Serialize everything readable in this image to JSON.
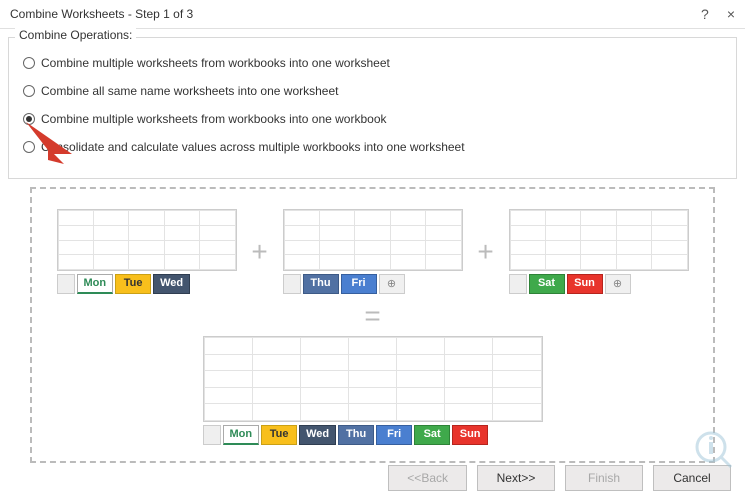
{
  "titlebar": {
    "title": "Combine Worksheets - Step 1 of 3",
    "help": "?",
    "close": "×"
  },
  "operations": {
    "legend": "Combine Operations:",
    "opt1": "Combine multiple worksheets from workbooks into one worksheet",
    "opt2": "Combine all same name worksheets into one worksheet",
    "opt3": "Combine multiple worksheets from workbooks into one workbook",
    "opt4": "Consolidate and calculate values across multiple workbooks into one worksheet"
  },
  "diagram": {
    "wb1": {
      "tabs": [
        "Mon",
        "Tue",
        "Wed"
      ]
    },
    "wb2": {
      "tabs": [
        "Thu",
        "Fri"
      ]
    },
    "wb3": {
      "tabs": [
        "Sat",
        "Sun"
      ]
    },
    "plus": "⊕",
    "op_plus": "+",
    "op_eq": "=",
    "result_tabs": [
      "Mon",
      "Tue",
      "Wed",
      "Thu",
      "Fri",
      "Sat",
      "Sun"
    ]
  },
  "buttons": {
    "back": "<<Back",
    "next": "Next>>",
    "finish": "Finish",
    "cancel": "Cancel"
  }
}
